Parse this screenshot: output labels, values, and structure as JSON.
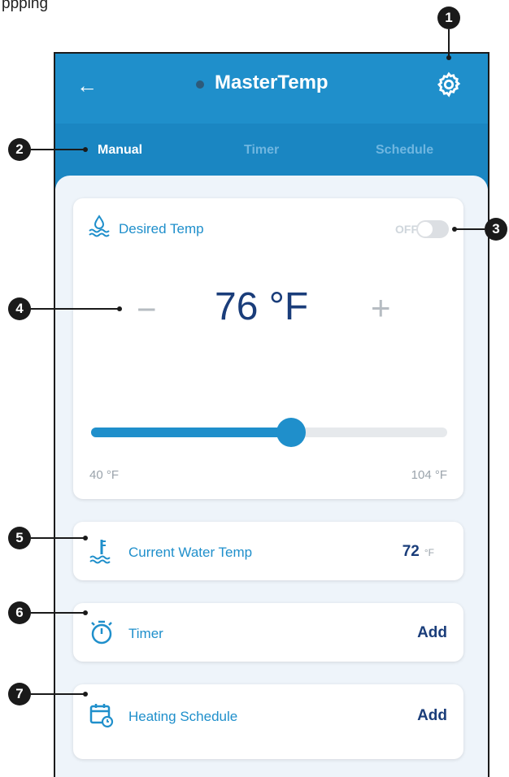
{
  "caption": "ppping",
  "app": {
    "title": "MasterTemp"
  },
  "tabs": [
    {
      "label": "Manual",
      "active": true
    },
    {
      "label": "Timer",
      "active": false
    },
    {
      "label": "Schedule",
      "active": false
    }
  ],
  "desired_temp": {
    "label": "Desired Temp",
    "toggle_label": "OFF",
    "value": "76 °F",
    "minus": "−",
    "plus": "+",
    "slider": {
      "min": 40,
      "max": 104,
      "value": 76
    },
    "range_min": "40 °F",
    "range_max": "104 °F"
  },
  "current_water": {
    "label": "Current Water Temp",
    "value": "72",
    "unit": "°F"
  },
  "timer": {
    "label": "Timer",
    "action": "Add"
  },
  "schedule": {
    "label": "Heating Schedule",
    "action": "Add"
  },
  "callouts": [
    "1",
    "2",
    "3",
    "4",
    "5",
    "6",
    "7"
  ],
  "colors": {
    "primary": "#1f8fcb",
    "header": "#1f8fcb",
    "text_dark": "#1a3d7a",
    "background": "#eef4fa"
  }
}
